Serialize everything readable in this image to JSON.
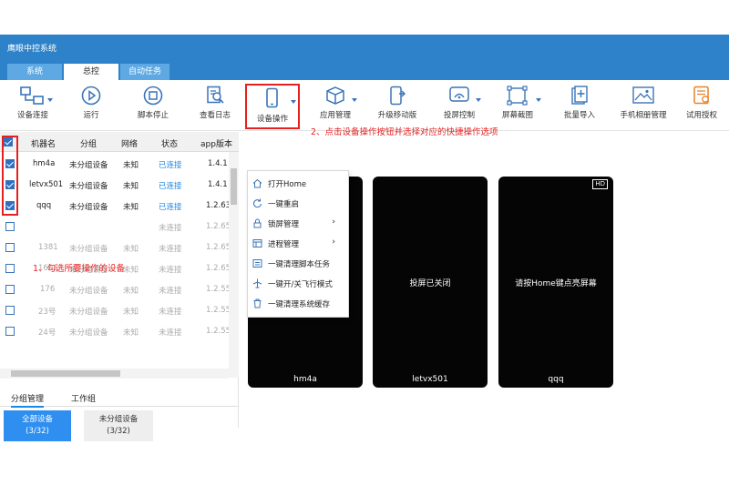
{
  "window": {
    "title": "鹰眼中控系统"
  },
  "tabs": [
    {
      "label": "系统"
    },
    {
      "label": "总控"
    },
    {
      "label": "自动任务"
    }
  ],
  "toolbar": [
    {
      "label": "设备连接",
      "icon": "device-connect-icon"
    },
    {
      "label": "运行",
      "icon": "play-icon"
    },
    {
      "label": "脚本停止",
      "icon": "stop-icon"
    },
    {
      "label": "查看日志",
      "icon": "log-icon"
    },
    {
      "label": "设备操作",
      "icon": "phone-icon"
    },
    {
      "label": "应用管理",
      "icon": "box-icon"
    },
    {
      "label": "升级移动版",
      "icon": "upgrade-mobile-icon"
    },
    {
      "label": "投屏控制",
      "icon": "cast-icon"
    },
    {
      "label": "屏幕截图",
      "icon": "screenshot-icon"
    },
    {
      "label": "批量导入",
      "icon": "import-icon"
    },
    {
      "label": "手机相册管理",
      "icon": "album-icon"
    },
    {
      "label": "试用授权",
      "icon": "license-icon"
    }
  ],
  "table": {
    "columns": [
      "机器名",
      "分组",
      "网络",
      "状态",
      "app版本"
    ],
    "rows": [
      {
        "name": "hm4a",
        "group": "未分组设备",
        "net": "未知",
        "status": "已连接",
        "ver": "1.4.1",
        "checked": true,
        "connected": true
      },
      {
        "name": "letvx501",
        "group": "未分组设备",
        "net": "未知",
        "status": "已连接",
        "ver": "1.4.1",
        "checked": true,
        "connected": true
      },
      {
        "name": "qqq",
        "group": "未分组设备",
        "net": "未知",
        "status": "已连接",
        "ver": "1.2.63",
        "checked": true,
        "connected": true
      },
      {
        "name": "",
        "group": "",
        "net": "",
        "status": "未连接",
        "ver": "1.2.65",
        "checked": false,
        "connected": false
      },
      {
        "name": "1381",
        "group": "未分组设备",
        "net": "未知",
        "status": "未连接",
        "ver": "1.2.65",
        "checked": false,
        "connected": false
      },
      {
        "name": "1601",
        "group": "未分组设备",
        "net": "未知",
        "status": "未连接",
        "ver": "1.2.65",
        "checked": false,
        "connected": false
      },
      {
        "name": "176",
        "group": "未分组设备",
        "net": "未知",
        "status": "未连接",
        "ver": "1.2.55",
        "checked": false,
        "connected": false
      },
      {
        "name": "23号",
        "group": "未分组设备",
        "net": "未知",
        "status": "未连接",
        "ver": "1.2.55",
        "checked": false,
        "connected": false
      },
      {
        "name": "24号",
        "group": "未分组设备",
        "net": "未知",
        "status": "未连接",
        "ver": "1.2.55",
        "checked": false,
        "connected": false
      }
    ]
  },
  "annotations": {
    "step1": "1、勾选所要操作的设备",
    "step2": "2、点击设备操作按钮并选择对应的快捷操作选项"
  },
  "group_tabs": [
    "分组管理",
    "工作组"
  ],
  "group_buttons": [
    {
      "label": "全部设备",
      "count": "(3/32)"
    },
    {
      "label": "未分组设备",
      "count": "(3/32)"
    }
  ],
  "menu": [
    {
      "label": "打开Home",
      "icon": "home-icon",
      "submenu": false
    },
    {
      "label": "一键重启",
      "icon": "restart-icon",
      "submenu": false
    },
    {
      "label": "锁屏管理",
      "icon": "lock-icon",
      "submenu": true
    },
    {
      "label": "进程管理",
      "icon": "process-icon",
      "submenu": true
    },
    {
      "label": "一键清理脚本任务",
      "icon": "clean-script-icon",
      "submenu": false
    },
    {
      "label": "一键开/关飞行模式",
      "icon": "airplane-icon",
      "submenu": false
    },
    {
      "label": "一键清理系统缓存",
      "icon": "trash-icon",
      "submenu": false
    }
  ],
  "cards": [
    {
      "name": "hm4a",
      "message": ""
    },
    {
      "name": "letvx501",
      "message": "投屏已关闭"
    },
    {
      "name": "qqq",
      "message": "请按Home键点亮屏幕",
      "badge": "HD"
    }
  ],
  "colors": {
    "titlebar": "#2e82c9",
    "accent": "#1e88e5",
    "annotation": "#e62020"
  }
}
